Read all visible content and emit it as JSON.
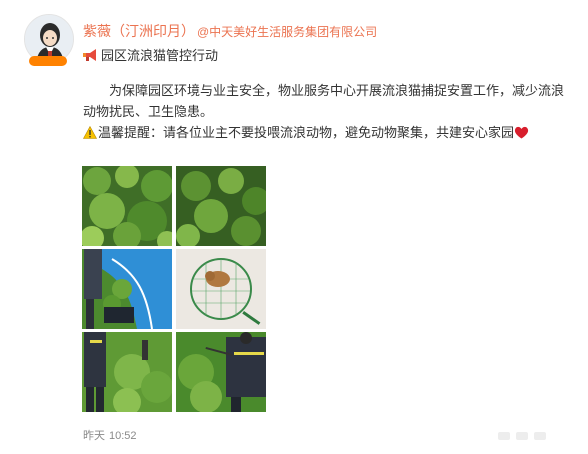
{
  "author": {
    "name": "紫薇（汀洲印月）",
    "org_mention": "@中天美好生活服务集团有限公司",
    "avatar_badge": "",
    "avatar_icon": "avatar-cartoon-woman"
  },
  "post": {
    "title_icon": "megaphone-icon",
    "title": "园区流浪猫管控行动",
    "paragraph": "为保障园区环境与业主安全，物业服务中心开展流浪猫捕捉安置工作，减少流浪动物扰民、卫生隐患。",
    "warning_icon": "warning-icon",
    "warning_text": "温馨提醒：请各位业主不要投喂流浪动物，避免动物聚集，共建安心家园",
    "heart_icon": "heart-icon",
    "images": [
      {
        "name": "photo-shrubs-1"
      },
      {
        "name": "photo-shrubs-2"
      },
      {
        "name": "photo-worker-blue-path"
      },
      {
        "name": "photo-cat-in-net"
      },
      {
        "name": "photo-worker-hedge"
      },
      {
        "name": "photo-worker-net"
      }
    ]
  },
  "meta": {
    "date": "昨天",
    "time": "10:52"
  },
  "colors": {
    "name": "#eb7350",
    "text": "#333333",
    "time": "#8a8a8a"
  }
}
